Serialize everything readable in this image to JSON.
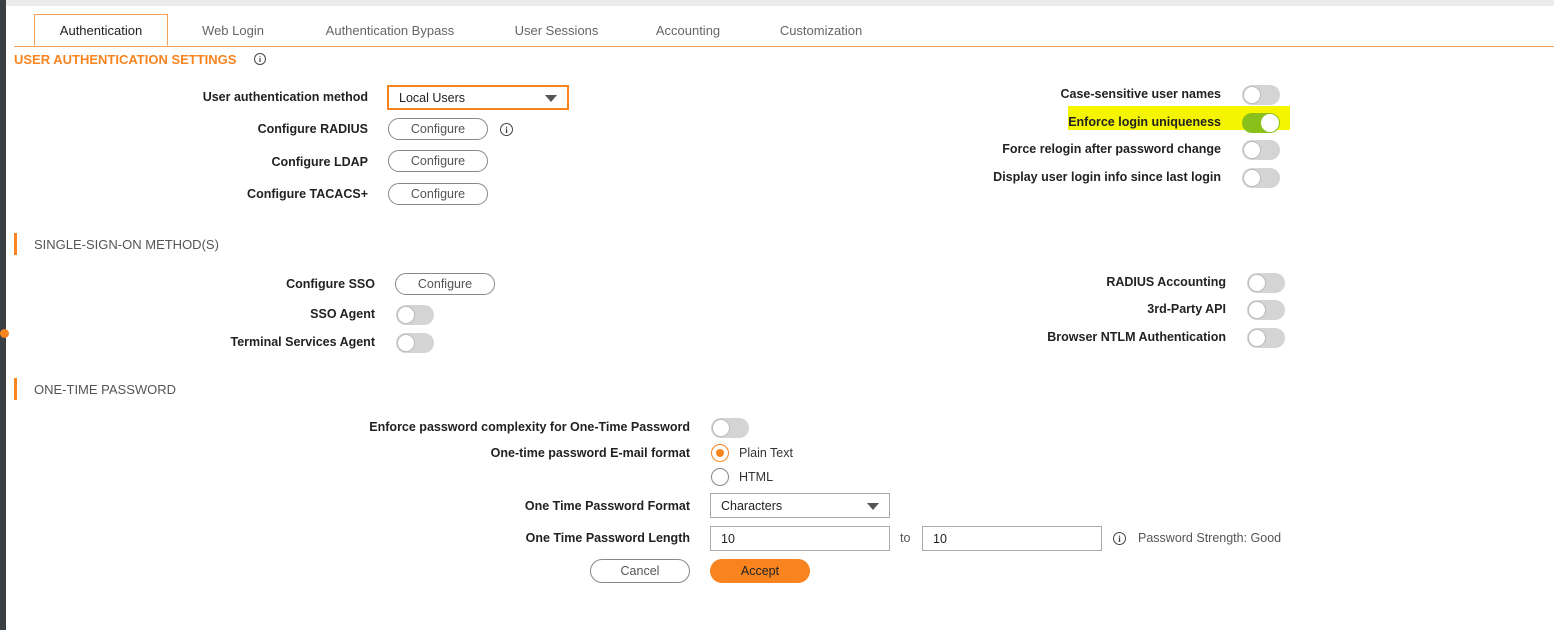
{
  "tabs": [
    {
      "label": "Authentication",
      "active": true
    },
    {
      "label": "Web Login"
    },
    {
      "label": "Authentication Bypass"
    },
    {
      "label": "User Sessions"
    },
    {
      "label": "Accounting"
    },
    {
      "label": "Customization"
    }
  ],
  "user_auth": {
    "title": "USER AUTHENTICATION SETTINGS",
    "method_label": "User authentication method",
    "method_value": "Local Users",
    "radius_label": "Configure RADIUS",
    "ldap_label": "Configure LDAP",
    "tacacs_label": "Configure TACACS+",
    "configure_btn": "Configure",
    "case_sensitive_label": "Case-sensitive user names",
    "case_sensitive_on": false,
    "enforce_unique_label": "Enforce login uniqueness",
    "enforce_unique_on": true,
    "force_relogin_label": "Force relogin after password change",
    "force_relogin_on": false,
    "display_login_label": "Display user login info since last login",
    "display_login_on": false
  },
  "sso": {
    "title": "SINGLE-SIGN-ON METHOD(S)",
    "configure_sso_label": "Configure SSO",
    "configure_btn": "Configure",
    "sso_agent_label": "SSO Agent",
    "sso_agent_on": false,
    "terminal_label": "Terminal Services Agent",
    "terminal_on": false,
    "radius_acct_label": "RADIUS Accounting",
    "radius_acct_on": false,
    "third_party_label": "3rd-Party API",
    "third_party_on": false,
    "ntlm_label": "Browser NTLM Authentication",
    "ntlm_on": false
  },
  "otp": {
    "title": "ONE-TIME PASSWORD",
    "complexity_label": "Enforce password complexity for One-Time Password",
    "complexity_on": false,
    "email_format_label": "One-time password E-mail format",
    "email_options": [
      {
        "label": "Plain Text",
        "checked": true
      },
      {
        "label": "HTML",
        "checked": false
      }
    ],
    "format_label": "One Time Password Format",
    "format_value": "Characters",
    "length_label": "One Time Password Length",
    "length_min": "10",
    "to_label": "to",
    "length_max": "10",
    "strength_text": "Password Strength: Good"
  },
  "actions": {
    "cancel_label": "Cancel",
    "accept_label": "Accept"
  },
  "colors": {
    "accent": "#f7841f",
    "toggle_on": "#89c019",
    "highlight": "#f5f500"
  }
}
